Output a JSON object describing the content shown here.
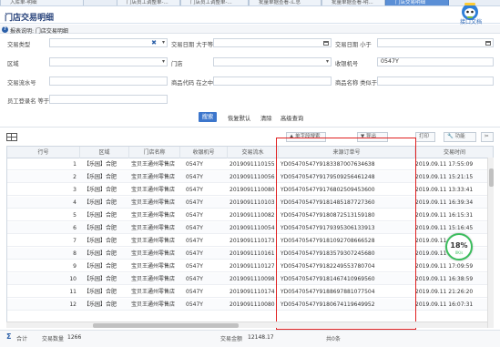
{
  "tabs": [
    {
      "label": "入库单-明细",
      "active": false
    },
    {
      "label": "门店员工调整单-...",
      "active": false
    },
    {
      "label": "门店员工调整单-...",
      "active": false
    },
    {
      "label": "批量单据查看-汇总",
      "active": false
    },
    {
      "label": "批量单据查看-明...",
      "active": false
    },
    {
      "label": "门店交易明细",
      "active": true
    }
  ],
  "page_title": "门店交易明细",
  "report_label": "报表说明: 门店交易明细",
  "help_label": "接口文档",
  "filters": {
    "trade_type_label": "交易类型",
    "trade_date_from_label": "交易日期 大于等于",
    "trade_date_to_label": "交易日期 小于",
    "region_label": "区域",
    "store_label": "门店",
    "cashier_label": "收银机号",
    "cashier_value": "0547Y",
    "trade_no_label": "交易流水号",
    "product_code_label": "商品代码 在之中",
    "product_name_label": "商品名称 类似于",
    "employee_label": "员工登录名 等于"
  },
  "actions": {
    "search": "搜索",
    "reset": "恢复默认",
    "clear": "清除",
    "advanced": "高级查询"
  },
  "toolbar": {
    "b1": "▲ 单字段搜索",
    "b2": "▼ 导出",
    "b3": "打印",
    "b4": "🔧 功能",
    "b5": "✂"
  },
  "columns": [
    "行号",
    "区域",
    "门店名称",
    "收银机号",
    "交易流水",
    "来源订单号",
    "交易时间"
  ],
  "rows": [
    {
      "no": "1",
      "region": "【乐园】合肥",
      "store": "宝贝王通州零售店",
      "cashier": "0547Y",
      "flow": "2019091110155",
      "order": "YD05470547Y9183387007634638",
      "time": "2019.09.11 17:55:09"
    },
    {
      "no": "2",
      "region": "【乐园】合肥",
      "store": "宝贝王通州零售店",
      "cashier": "0547Y",
      "flow": "2019091110056",
      "order": "YD05470547Y9179509256461248",
      "time": "2019.09.11 15:21:15"
    },
    {
      "no": "3",
      "region": "【乐园】合肥",
      "store": "宝贝王通州零售店",
      "cashier": "0547Y",
      "flow": "2019091110080",
      "order": "YD05470547Y9176802509453600",
      "time": "2019.09.11 13:33:41"
    },
    {
      "no": "4",
      "region": "【乐园】合肥",
      "store": "宝贝王通州零售店",
      "cashier": "0547Y",
      "flow": "2019091110103",
      "order": "YD05470547Y9181485187727360",
      "time": "2019.09.11 16:39:34"
    },
    {
      "no": "5",
      "region": "【乐园】合肥",
      "store": "宝贝王通州零售店",
      "cashier": "0547Y",
      "flow": "2019091110082",
      "order": "YD05470547Y9180872513159180",
      "time": "2019.09.11 16:15:31"
    },
    {
      "no": "6",
      "region": "【乐园】合肥",
      "store": "宝贝王通州零售店",
      "cashier": "0547Y",
      "flow": "2019091110054",
      "order": "YD05470547Y9179395306133913",
      "time": "2019.09.11 15:16:45"
    },
    {
      "no": "7",
      "region": "【乐园】合肥",
      "store": "宝贝王通州零售店",
      "cashier": "0547Y",
      "flow": "2019091110173",
      "order": "YD05470547Y9181092708666528",
      "time": "2019.09.11 16:"
    },
    {
      "no": "8",
      "region": "【乐园】合肥",
      "store": "宝贝王通州零售店",
      "cashier": "0547Y",
      "flow": "2019091110161",
      "order": "YD05470547Y9183579307245680",
      "time": "2019.09.11 17:"
    },
    {
      "no": "9",
      "region": "【乐园】合肥",
      "store": "宝贝王通州零售店",
      "cashier": "0547Y",
      "flow": "2019091110127",
      "order": "YD05470547Y9182249553780704",
      "time": "2019.09.11 17:09:59"
    },
    {
      "no": "10",
      "region": "【乐园】合肥",
      "store": "宝贝王通州零售店",
      "cashier": "0547Y",
      "flow": "2019091110098",
      "order": "YD05470547Y9181467410969560",
      "time": "2019.09.11 16:38:59"
    },
    {
      "no": "11",
      "region": "【乐园】合肥",
      "store": "宝贝王通州零售店",
      "cashier": "0547Y",
      "flow": "2019091110174",
      "order": "YD05470547Y9188697881077504",
      "time": "2019.09.11 21:26:20"
    },
    {
      "no": "12",
      "region": "【乐园】合肥",
      "store": "宝贝王通州零售店",
      "cashier": "0547Y",
      "flow": "2019091110080",
      "order": "YD05470547Y9180674119649952",
      "time": "2019.09.11 16:07:31"
    }
  ],
  "footer": {
    "sum_label": "合计",
    "count_label": "交易数量",
    "count_value": "1266",
    "amount_label": "交易金额",
    "amount_value": "12148.17",
    "page_label": "共0条"
  },
  "speed_widget": {
    "percent": "18%",
    "rate": "0K/s"
  }
}
